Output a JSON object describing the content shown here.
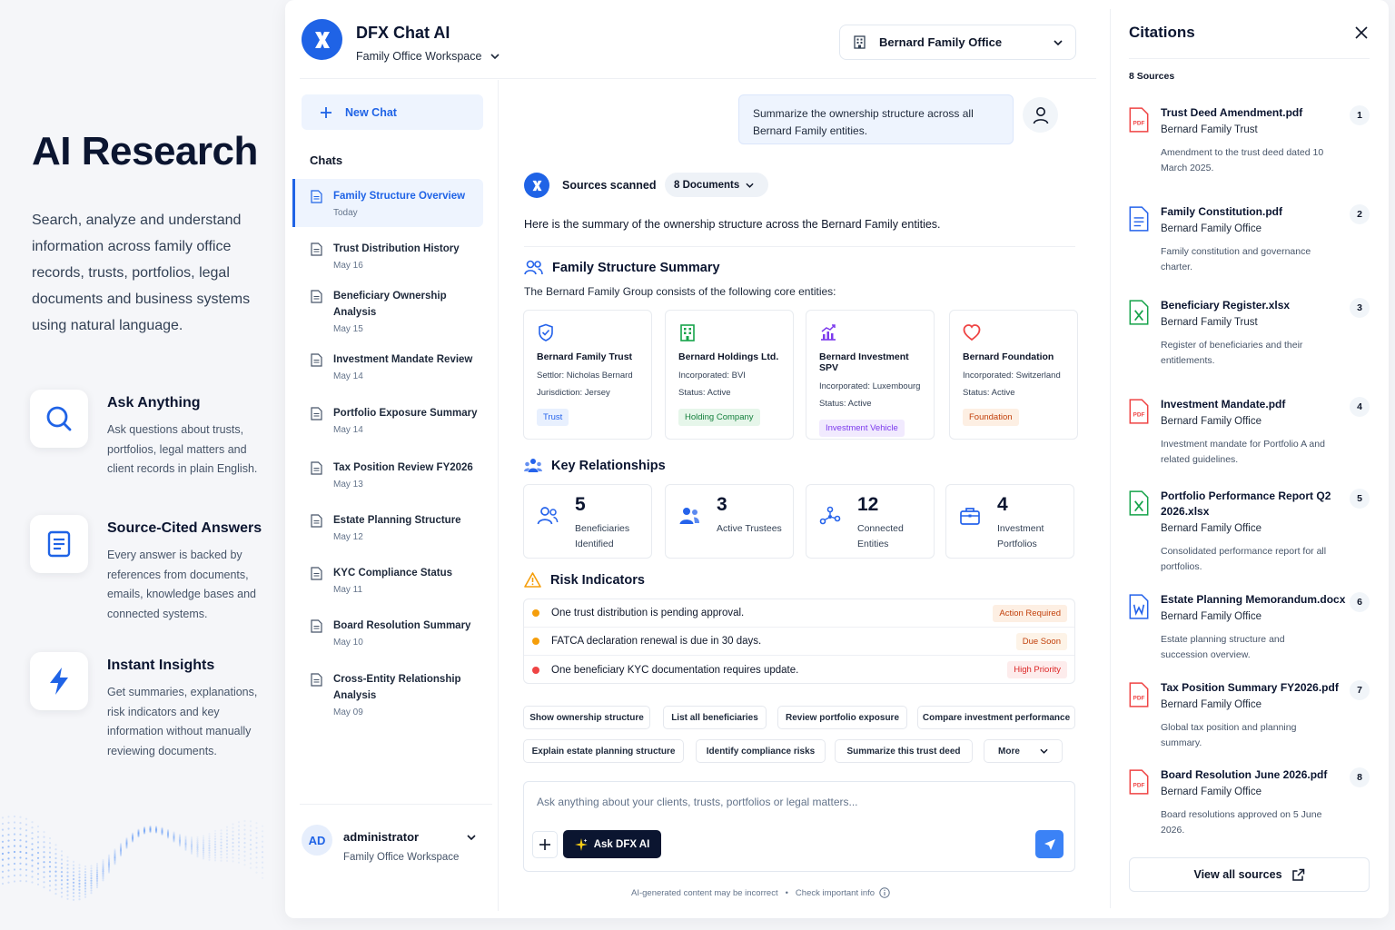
{
  "hero": {
    "title": "AI Research",
    "description": "Search, analyze and understand information across family office records, trusts, portfolios, legal documents and business systems using natural language."
  },
  "features": [
    {
      "icon": "search-icon",
      "title": "Ask Anything",
      "description": "Ask questions about trusts, portfolios, legal matters and client records in plain English."
    },
    {
      "icon": "document-icon",
      "title": "Source-Cited Answers",
      "description": "Every answer is backed by references from documents, emails, knowledge bases and connected systems."
    },
    {
      "icon": "lightning-icon",
      "title": "Instant Insights",
      "description": "Get summaries, explanations, risk indicators and key information without manually reviewing documents."
    }
  ],
  "app": {
    "title": "DFX Chat AI",
    "workspace": "Family Office Workspace",
    "entity_select": "Bernard Family Office"
  },
  "sidebar": {
    "new_chat": "New Chat",
    "chats_label": "Chats",
    "chats": [
      {
        "title": "Family Structure Overview",
        "date": "Today",
        "active": true
      },
      {
        "title": "Trust Distribution History",
        "date": "May 16"
      },
      {
        "title": "Beneficiary Ownership Analysis",
        "date": "May 15"
      },
      {
        "title": "Investment Mandate Review",
        "date": "May 14"
      },
      {
        "title": "Portfolio Exposure Summary",
        "date": "May 14"
      },
      {
        "title": "Tax Position Review FY2026",
        "date": "May 13"
      },
      {
        "title": "Estate Planning Structure",
        "date": "May 12"
      },
      {
        "title": "KYC Compliance Status",
        "date": "May 11"
      },
      {
        "title": "Board Resolution Summary",
        "date": "May 10"
      },
      {
        "title": "Cross-Entity Relationship Analysis",
        "date": "May 09"
      }
    ],
    "user": {
      "initials": "AD",
      "name": "administrator",
      "workspace": "Family Office Workspace"
    }
  },
  "chat": {
    "user_message": "Summarize the ownership structure across all Bernard Family entities.",
    "sources_scanned": "Sources scanned",
    "documents_pill": "8 Documents",
    "intro": "Here is the summary of the ownership structure across the Bernard Family entities.",
    "structure_title": "Family Structure Summary",
    "structure_sub": "The Bernard Family Group consists of the following core entities:",
    "entities": [
      {
        "icon": "shield-icon",
        "name": "Bernard Family Trust",
        "line1": "Settlor: Nicholas Bernard",
        "line2": "Jurisdiction: Jersey",
        "tag": "Trust",
        "tag_color": "#2563eb",
        "tag_bg": "#e8f0fe"
      },
      {
        "icon": "building-icon",
        "name": "Bernard Holdings Ltd.",
        "line1": "Incorporated: BVI",
        "line2": "Status: Active",
        "tag": "Holding Company",
        "tag_color": "#15803d",
        "tag_bg": "#e6f6ea"
      },
      {
        "icon": "chart-growth-icon",
        "name": "Bernard Investment SPV",
        "line1": "Incorporated: Luxembourg",
        "line2": "Status: Active",
        "tag": "Investment Vehicle",
        "tag_color": "#7c3aed",
        "tag_bg": "#f1eafe"
      },
      {
        "icon": "heart-icon",
        "name": "Bernard Foundation",
        "line1": "Incorporated: Switzerland",
        "line2": "Status: Active",
        "tag": "Foundation",
        "tag_color": "#c2410c",
        "tag_bg": "#fdefe3"
      }
    ],
    "relationships_title": "Key Relationships",
    "stats": [
      {
        "icon": "users-icon",
        "number": "5",
        "label": "Beneficiaries Identified"
      },
      {
        "icon": "user-group-icon",
        "number": "3",
        "label": "Active Trustees"
      },
      {
        "icon": "network-icon",
        "number": "12",
        "label": "Connected Entities"
      },
      {
        "icon": "briefcase-icon",
        "number": "4",
        "label": "Investment Portfolios"
      }
    ],
    "risk_title": "Risk Indicators",
    "risks": [
      {
        "text": "One trust distribution is pending approval.",
        "badge": "Action Required",
        "dot": "#f59e0b",
        "badge_color": "#c2410c",
        "badge_bg": "#fdefe3"
      },
      {
        "text": "FATCA declaration renewal is due in 30 days.",
        "badge": "Due Soon",
        "dot": "#f59e0b",
        "badge_color": "#c2410c",
        "badge_bg": "#fdf3e7"
      },
      {
        "text": "One beneficiary KYC documentation requires update.",
        "badge": "High Priority",
        "dot": "#ef4444",
        "badge_color": "#dc2626",
        "badge_bg": "#fdecec"
      }
    ],
    "suggestions_row1": [
      "Show ownership structure",
      "List all beneficiaries",
      "Review portfolio exposure",
      "Compare investment performance"
    ],
    "suggestions_row2": [
      "Explain estate planning structure",
      "Identify compliance risks",
      "Summarize this trust deed",
      "More"
    ],
    "composer_placeholder": "Ask anything about your clients, trusts, portfolios or legal matters...",
    "ask_button": "Ask DFX AI",
    "disclaimer_left": "AI-generated content may be incorrect",
    "disclaimer_right": "Check important info"
  },
  "citations": {
    "title": "Citations",
    "count": "8 Sources",
    "items": [
      {
        "num": "1",
        "type": "pdf",
        "title": "Trust Deed Amendment.pdf",
        "org": "Bernard Family Trust",
        "desc": "Amendment to the trust deed dated 10 March 2025."
      },
      {
        "num": "2",
        "type": "doc",
        "title": "Family Constitution.pdf",
        "org": "Bernard Family Office",
        "desc": "Family constitution and governance charter."
      },
      {
        "num": "3",
        "type": "xls",
        "title": "Beneficiary Register.xlsx",
        "org": "Bernard Family Trust",
        "desc": "Register of beneficiaries and their entitlements."
      },
      {
        "num": "4",
        "type": "pdf",
        "title": "Investment Mandate.pdf",
        "org": "Bernard Family Office",
        "desc": "Investment mandate for Portfolio A and related guidelines."
      },
      {
        "num": "5",
        "type": "xls",
        "title": "Portfolio Performance Report Q2 2026.xlsx",
        "org": "Bernard Family Office",
        "desc": "Consolidated performance report for all portfolios."
      },
      {
        "num": "6",
        "type": "word",
        "title": "Estate Planning Memorandum.docx",
        "org": "Bernard Family Office",
        "desc": "Estate planning structure and succession overview."
      },
      {
        "num": "7",
        "type": "pdf",
        "title": "Tax Position Summary FY2026.pdf",
        "org": "Bernard Family Office",
        "desc": "Global tax position and planning summary."
      },
      {
        "num": "8",
        "type": "pdf",
        "title": "Board Resolution June 2026.pdf",
        "org": "Bernard Family Office",
        "desc": "Board resolutions approved on 5 June 2026."
      }
    ],
    "view_all": "View all sources"
  }
}
